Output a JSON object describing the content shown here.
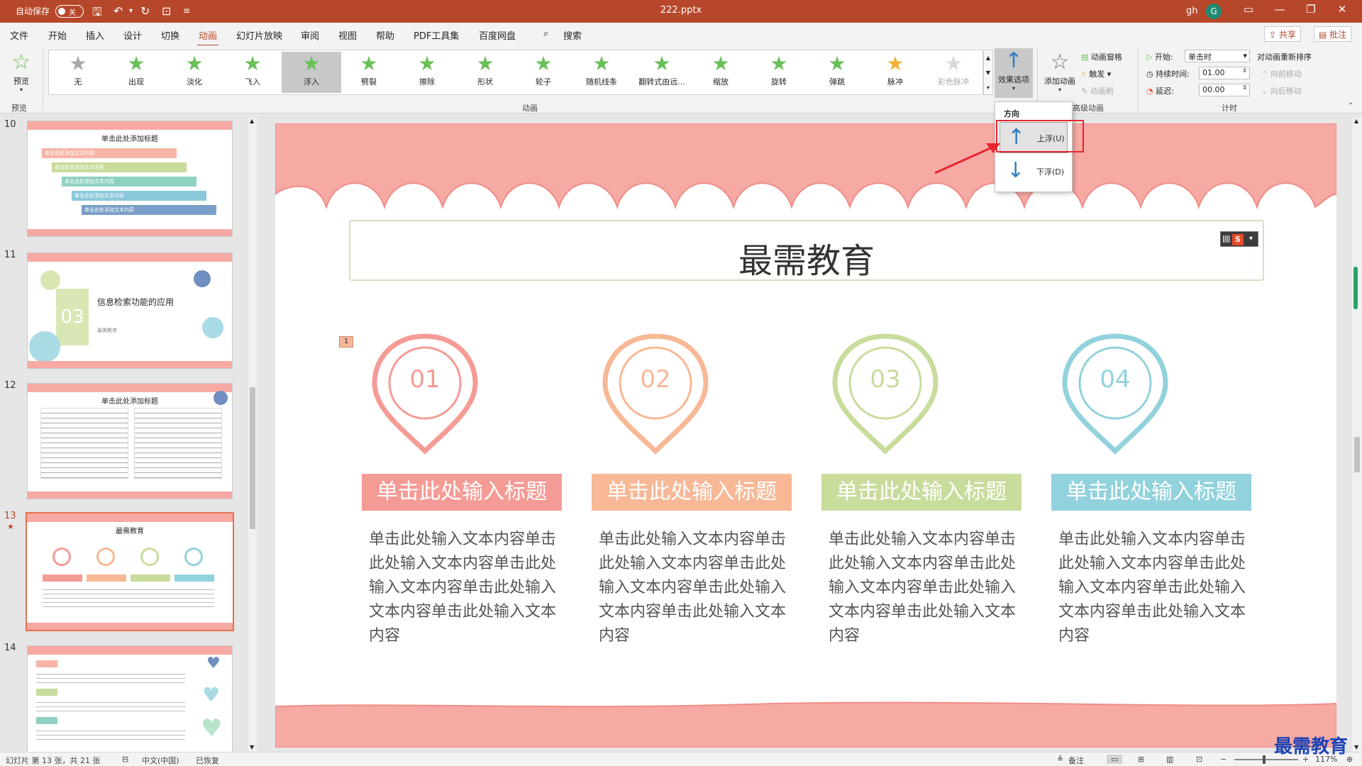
{
  "titlebar": {
    "autosave_label": "自动保存",
    "autosave_state": "关",
    "filename": "222.pptx",
    "user_name": "gh",
    "avatar_letter": "G",
    "search_label": "搜索"
  },
  "menu": {
    "tabs": [
      "文件",
      "开始",
      "插入",
      "设计",
      "切换",
      "动画",
      "幻灯片放映",
      "审阅",
      "视图",
      "帮助",
      "PDF工具集",
      "百度网盘"
    ],
    "active_tab": "动画",
    "share": "共享",
    "comment": "批注"
  },
  "ribbon": {
    "preview_label": "预览",
    "preview_group": "预览",
    "animation_group": "动画",
    "advanced_group": "高级动画",
    "timing_group": "计时",
    "effects": [
      {
        "label": "无",
        "style": "gray"
      },
      {
        "label": "出现",
        "style": "green"
      },
      {
        "label": "淡化",
        "style": "green"
      },
      {
        "label": "飞入",
        "style": "green"
      },
      {
        "label": "浮入",
        "style": "green"
      },
      {
        "label": "劈裂",
        "style": "green"
      },
      {
        "label": "擦除",
        "style": "green"
      },
      {
        "label": "形状",
        "style": "green"
      },
      {
        "label": "轮子",
        "style": "green"
      },
      {
        "label": "随机线条",
        "style": "green"
      },
      {
        "label": "翻转式由远...",
        "style": "green"
      },
      {
        "label": "缩放",
        "style": "green"
      },
      {
        "label": "旋转",
        "style": "green"
      },
      {
        "label": "弹跳",
        "style": "green"
      },
      {
        "label": "脉冲",
        "style": "gold"
      },
      {
        "label": "彩色脉冲",
        "style": "faded"
      }
    ],
    "selected_effect": "浮入",
    "effect_options_label": "效果选项",
    "add_animation_label": "添加动画",
    "animation_pane": "动画窗格",
    "trigger": "触发",
    "animation_painter": "动画刷",
    "start_label": "开始:",
    "start_value": "单击时",
    "duration_label": "持续时间:",
    "duration_value": "01.00",
    "delay_label": "延迟:",
    "delay_value": "00.00",
    "reorder_label": "对动画重新排序",
    "move_earlier": "向前移动",
    "move_later": "向后移动"
  },
  "dropdown": {
    "heading": "方向",
    "items": [
      "上浮(U)",
      "下浮(D)"
    ],
    "selected": "上浮(U)"
  },
  "thumbnails": [
    {
      "number": "10",
      "title": "单击此处添加标题",
      "bars": [
        "单击此处添加文本内容",
        "单击此处添加文本内容",
        "单击此处添加文本内容",
        "单击此处添加文本内容",
        "单击此处添加文本内容"
      ]
    },
    {
      "number": "11",
      "badge": "03",
      "text": "信息检索功能的应用",
      "sub": "最需教育"
    },
    {
      "number": "12",
      "title": "单击此处添加标题"
    },
    {
      "number": "13",
      "title": "最需教育",
      "active": true
    },
    {
      "number": "14"
    }
  ],
  "slide": {
    "title": "最需教育",
    "anim_tag": "1",
    "columns": [
      {
        "number": "01",
        "color": "#f59b95",
        "title": "单击此处输入标题",
        "body": "单击此处输入文本内容单击此处输入文本内容单击此处输入文本内容单击此处输入文本内容单击此处输入文本内容"
      },
      {
        "number": "02",
        "color": "#f8b896",
        "title": "单击此处输入标题",
        "body": "单击此处输入文本内容单击此处输入文本内容单击此处输入文本内容单击此处输入文本内容单击此处输入文本内容"
      },
      {
        "number": "03",
        "color": "#c8dc9c",
        "title": "单击此处输入标题",
        "body": "单击此处输入文本内容单击此处输入文本内容单击此处输入文本内容单击此处输入文本内容单击此处输入文本内容"
      },
      {
        "number": "04",
        "color": "#92d2dc",
        "title": "单击此处输入标题",
        "body": "单击此处输入文本内容单击此处输入文本内容单击此处输入文本内容单击此处输入文本内容单击此处输入文本内容"
      }
    ]
  },
  "statusbar": {
    "slide_info": "幻灯片 第 13 张，共 21 张",
    "language": "中文(中国)",
    "recovered": "已恢复",
    "notes": "备注",
    "zoom": "117%"
  },
  "watermark": "最需教育",
  "colors": {
    "accent": "#b7472a",
    "wave": "#f7a9a4",
    "highlight": "#e8262d"
  }
}
